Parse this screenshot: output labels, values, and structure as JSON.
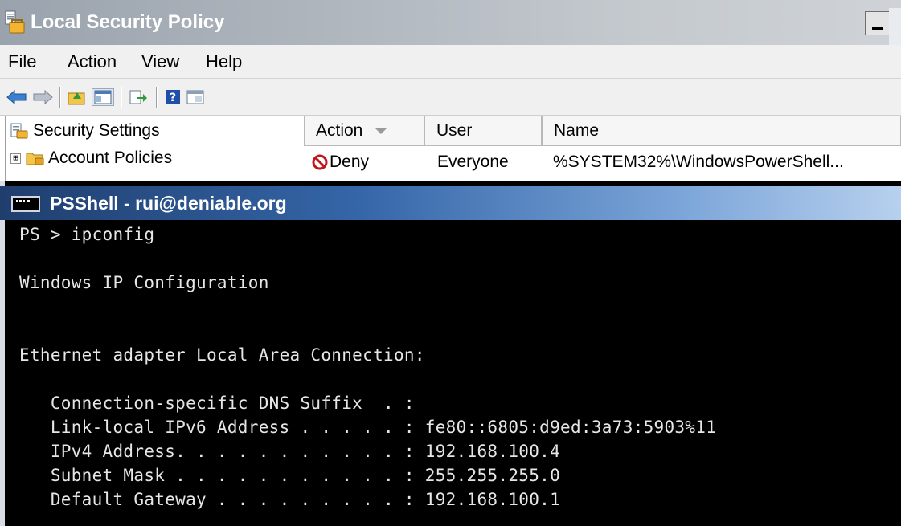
{
  "lsp_window": {
    "title": "Local Security Policy",
    "menu": [
      "File",
      "Action",
      "View",
      "Help"
    ],
    "tree": [
      {
        "label": "Security Settings",
        "icon": "security-settings-icon"
      },
      {
        "label": "Account Policies",
        "icon": "folder-icon",
        "expander": "⊞"
      }
    ],
    "columns": [
      "Action",
      "User",
      "Name"
    ],
    "row": {
      "action": "Deny",
      "user": "Everyone",
      "name": "%SYSTEM32%\\WindowsPowerShell..."
    }
  },
  "ps_window": {
    "title": "PSShell - rui@deniable.org",
    "console_lines": [
      "PS > ipconfig",
      "",
      "Windows IP Configuration",
      "",
      "",
      "Ethernet adapter Local Area Connection:",
      "",
      "   Connection-specific DNS Suffix  . :",
      "   Link-local IPv6 Address . . . . . : fe80::6805:d9ed:3a73:5903%11",
      "   IPv4 Address. . . . . . . . . . . : 192.168.100.4",
      "   Subnet Mask . . . . . . . . . . . : 255.255.255.0",
      "   Default Gateway . . . . . . . . . : 192.168.100.1"
    ]
  },
  "colors": {
    "lsp_title_gradient": "#9aa3ad",
    "ps_title_gradient": "#3566a8",
    "console_bg": "#000000",
    "console_fg": "#e6e6e6",
    "deny_icon": "#c0161b"
  }
}
